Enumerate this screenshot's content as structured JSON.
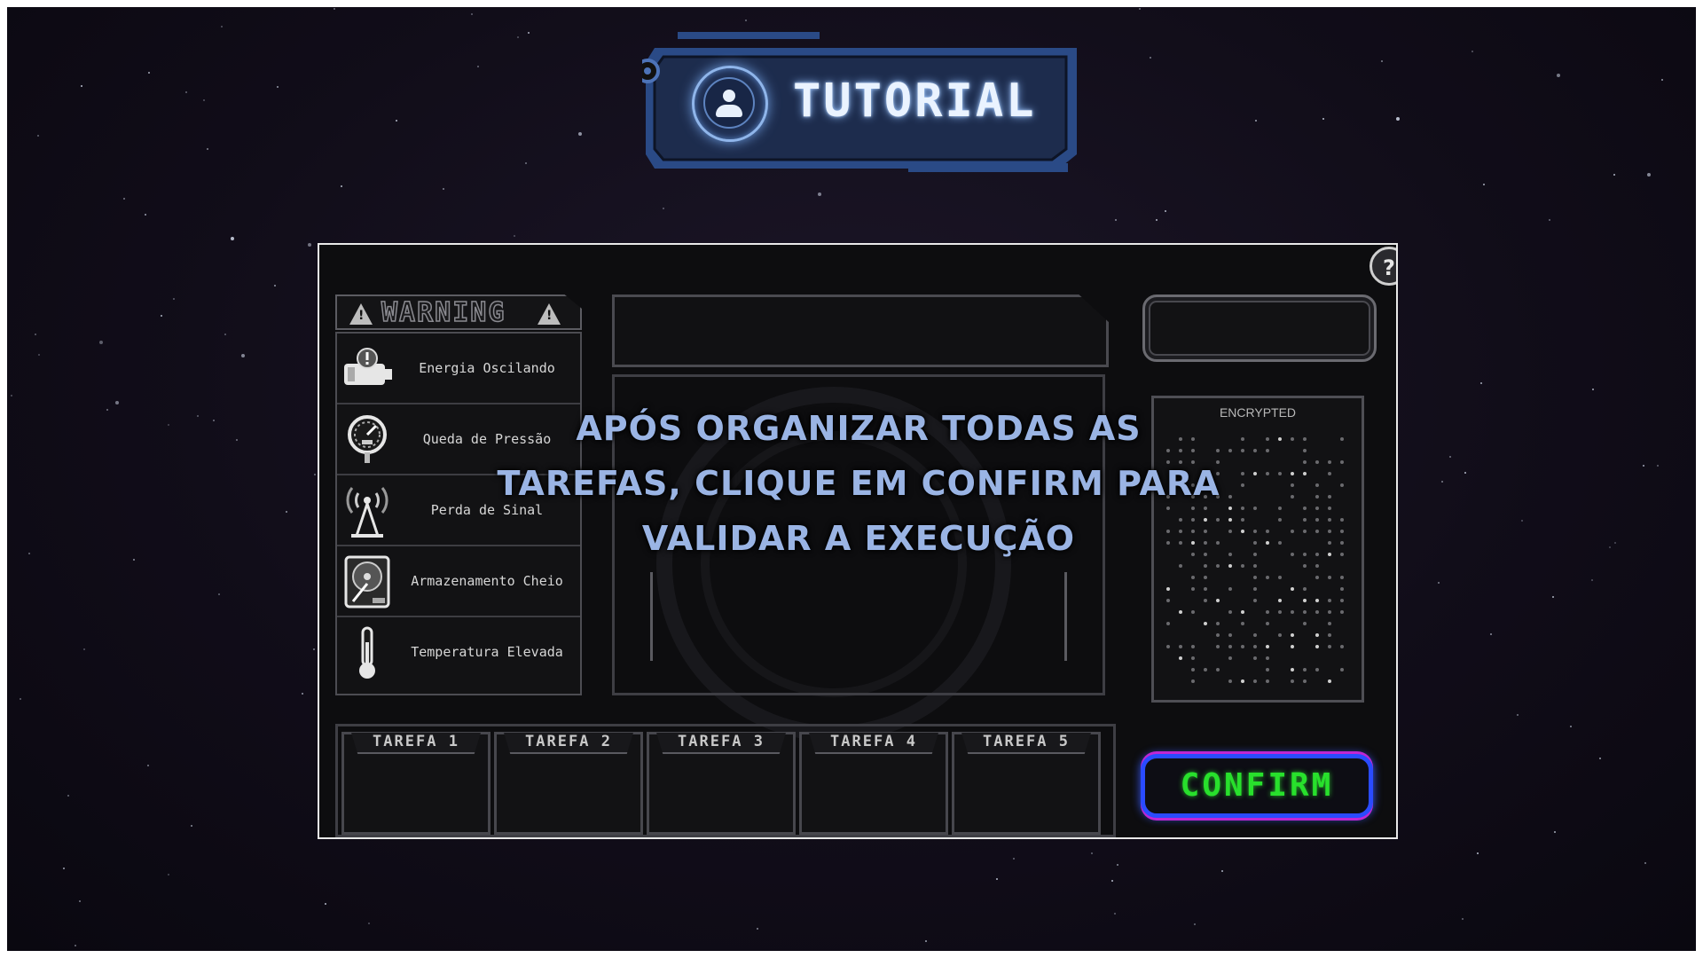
{
  "banner": {
    "title": "TUTORIAL",
    "icon": "user-icon",
    "accent": "#2f4f8f"
  },
  "instruction": {
    "line1": "APÓS ORGANIZAR TODAS AS",
    "line2": "TAREFAS, CLIQUE EM CONFIRM PARA",
    "line3": "VALIDAR A EXECUÇÃO"
  },
  "game": {
    "help_label": "?",
    "warning_title": "WARNING",
    "warnings": [
      {
        "label": "Energia Oscilando",
        "icon": "battery-warning-icon"
      },
      {
        "label": "Queda de Pressão",
        "icon": "pressure-gauge-icon"
      },
      {
        "label": "Perda de Sinal",
        "icon": "antenna-icon"
      },
      {
        "label": "Armazenamento Cheio",
        "icon": "hard-drive-icon"
      },
      {
        "label": "Temperatura Elevada",
        "icon": "thermometer-icon"
      }
    ],
    "encrypted_label": "ENCRYPTED",
    "tasks": [
      "TAREFA 1",
      "TAREFA 2",
      "TAREFA 3",
      "TAREFA 4",
      "TAREFA 5"
    ],
    "confirm_label": "CONFIRM",
    "colors": {
      "confirm_text": "#28e02c",
      "confirm_border": "#2a4bff",
      "confirm_glow": "#c026d3",
      "instruction_text": "#9ab4e4"
    }
  }
}
